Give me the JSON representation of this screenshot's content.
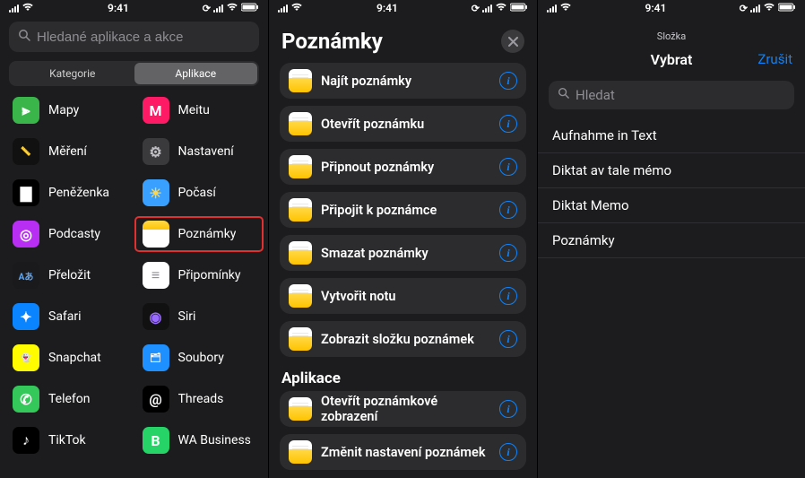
{
  "status": {
    "time": "9:41"
  },
  "panel1": {
    "search_placeholder": "Hledané aplikace a akce",
    "seg_left": "Kategorie",
    "seg_right": "Aplikace",
    "apps_left": [
      {
        "key": "mapy",
        "label": "Mapy",
        "icon_bg": "#39b54a",
        "glyph": "⫸",
        "glyph_color": "#fff"
      },
      {
        "key": "mereni",
        "label": "Měření",
        "icon_bg": "#111",
        "glyph": "📏",
        "glyph_color": "#fff"
      },
      {
        "key": "penezenka",
        "label": "Peněženka",
        "icon_bg": "#000",
        "glyph": "▇",
        "glyph_color": "#fff"
      },
      {
        "key": "podcasty",
        "label": "Podcasty",
        "icon_bg": "#b82ef2",
        "glyph": "◎",
        "glyph_color": "#fff"
      },
      {
        "key": "prelozit",
        "label": "Přeložit",
        "icon_bg": "#1a1a1c",
        "glyph": "Aあ",
        "glyph_color": "#5aa9ff"
      },
      {
        "key": "safari",
        "label": "Safari",
        "icon_bg": "#0b84ff",
        "glyph": "✦",
        "glyph_color": "#fff"
      },
      {
        "key": "snapchat",
        "label": "Snapchat",
        "icon_bg": "#fffc00",
        "glyph": "👻",
        "glyph_color": "#000"
      },
      {
        "key": "telefon",
        "label": "Telefon",
        "icon_bg": "#34c759",
        "glyph": "✆",
        "glyph_color": "#fff"
      },
      {
        "key": "tiktok",
        "label": "TikTok",
        "icon_bg": "#000",
        "glyph": "♪",
        "glyph_color": "#fff"
      }
    ],
    "apps_right": [
      {
        "key": "meitu",
        "label": "Meitu",
        "icon_bg": "#ff1a66",
        "glyph": "M",
        "glyph_color": "#fff"
      },
      {
        "key": "nastaveni",
        "label": "Nastavení",
        "icon_bg": "#3a3a3c",
        "glyph": "⚙",
        "glyph_color": "#bfbfc4"
      },
      {
        "key": "pocasi",
        "label": "Počasí",
        "icon_bg": "#3aa0ff",
        "glyph": "☀",
        "glyph_color": "#ffd54a"
      },
      {
        "key": "poznamky",
        "label": "Poznámky",
        "icon_bg": "#fff",
        "glyph": "",
        "glyph_color": "#000",
        "highlight": true,
        "notes": true
      },
      {
        "key": "pripominky",
        "label": "Připomínky",
        "icon_bg": "#fff",
        "glyph": "≡",
        "glyph_color": "#8e8e93"
      },
      {
        "key": "siri",
        "label": "Siri",
        "icon_bg": "#111",
        "glyph": "◉",
        "glyph_color": "#9a6bff"
      },
      {
        "key": "soubory",
        "label": "Soubory",
        "icon_bg": "#1e90ff",
        "glyph": "🗂",
        "glyph_color": "#fff"
      },
      {
        "key": "threads",
        "label": "Threads",
        "icon_bg": "#000",
        "glyph": "@",
        "glyph_color": "#fff"
      },
      {
        "key": "wab",
        "label": "WA Business",
        "icon_bg": "#25d366",
        "glyph": "B",
        "glyph_color": "#fff"
      }
    ]
  },
  "panel2": {
    "title": "Poznámky",
    "actions": [
      {
        "label": "Najít poznámky"
      },
      {
        "label": "Otevřít poznámku"
      },
      {
        "label": "Připnout poznámky"
      },
      {
        "label": "Připojit k poznámce"
      },
      {
        "label": "Smazat poznámky"
      },
      {
        "label": "Vytvořit notu"
      },
      {
        "label": "Zobrazit složku poznámek"
      }
    ],
    "section2_title": "Aplikace",
    "actions2": [
      {
        "label": "Otevřít poznámkové zobrazení"
      },
      {
        "label": "Změnit nastavení poznámek"
      }
    ]
  },
  "panel3": {
    "sheet_label": "Složka",
    "nav_title": "Vybrat",
    "cancel": "Zrušit",
    "search_placeholder": "Hledat",
    "rows": [
      "Aufnahme in Text",
      "Diktat av tale mémo",
      "Diktat Memo",
      "Poznámky"
    ]
  }
}
